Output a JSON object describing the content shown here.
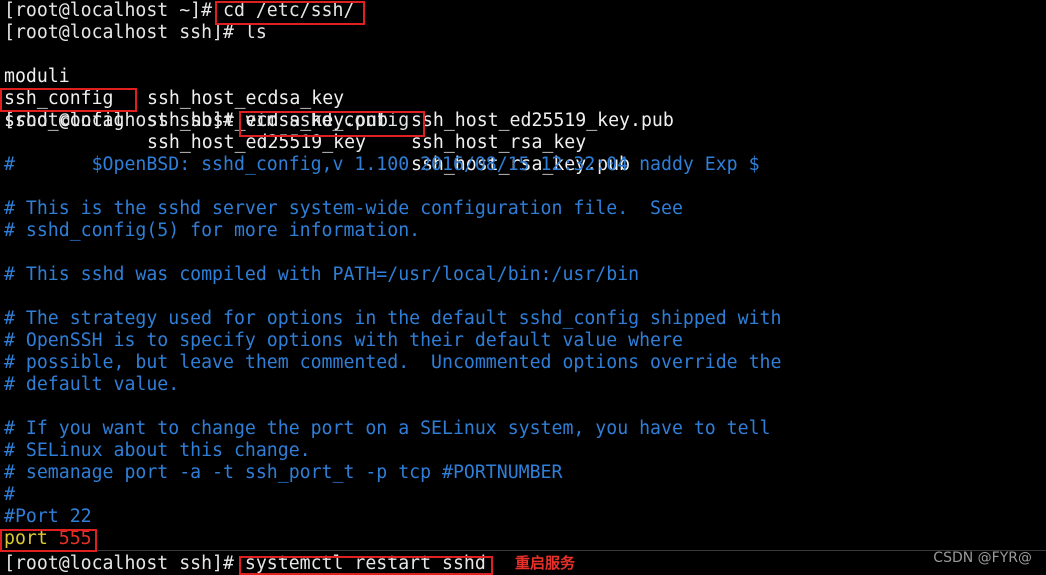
{
  "terminal": {
    "commands": [
      {
        "prompt": "[root@localhost ~]#",
        "command": " cd /etc/ssh/"
      },
      {
        "prompt": "[root@localhost ssh]#",
        "command": " ls"
      }
    ],
    "ls_output": {
      "col1": [
        "moduli",
        "ssh_config",
        "sshd_config"
      ],
      "col2": [
        "ssh_host_ecdsa_key",
        "ssh_host_ecdsa_key.pub",
        "ssh_host_ed25519_key"
      ],
      "col3": [
        "ssh_host_ed25519_key.pub",
        "ssh_host_rsa_key",
        "ssh_host_rsa_key.pub"
      ]
    },
    "vim_prompt": "[root@localhost ssh]#",
    "vim_command": " vim sshd_config",
    "file_lines": [
      "#       $OpenBSD: sshd_config,v 1.100 2016/08/15 12:32:04 naddy Exp $",
      "",
      "# This is the sshd server system-wide configuration file.  See",
      "# sshd_config(5) for more information.",
      "",
      "# This sshd was compiled with PATH=/usr/local/bin:/usr/bin",
      "",
      "# The strategy used for options in the default sshd_config shipped with",
      "# OpenSSH is to specify options with their default value where",
      "# possible, but leave them commented.  Uncommented options override the",
      "# default value.",
      "",
      "# If you want to change the port on a SELinux system, you have to tell",
      "# SELinux about this change.",
      "# semanage port -a -t ssh_port_t -p tcp #PORTNUMBER",
      "#",
      "#Port 22"
    ],
    "port_keyword": "port",
    "port_value": " 555",
    "restart_prompt": "[root@localhost ssh]#",
    "restart_command": " systemctl restart sshd",
    "annotation": "重启服务",
    "watermark": "CSDN @FYR@"
  },
  "colors": {
    "comment": "#2f7fd8",
    "keyword": "#dcc832",
    "value": "#e8302a",
    "highlight_box": "#e02020"
  }
}
